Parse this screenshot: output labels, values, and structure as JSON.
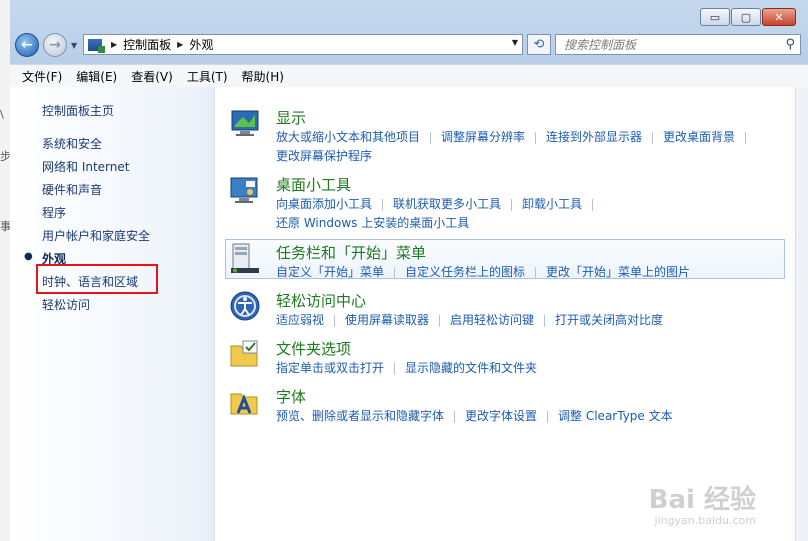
{
  "window": {
    "minimize_glyph": "▭",
    "maximize_glyph": "▢",
    "close_glyph": "✕"
  },
  "nav": {
    "breadcrumb": [
      "控制面板",
      "外观"
    ],
    "search_placeholder": "搜索控制面板"
  },
  "menu": [
    "文件(F)",
    "编辑(E)",
    "查看(V)",
    "工具(T)",
    "帮助(H)"
  ],
  "sidebar": {
    "home": "控制面板主页",
    "items": [
      "系统和安全",
      "网络和 Internet",
      "硬件和声音",
      "程序",
      "用户帐户和家庭安全",
      "外观",
      "时钟、语言和区域",
      "轻松访问"
    ],
    "current": "外观"
  },
  "categories": [
    {
      "title": "显示",
      "icon": "display-icon",
      "links": [
        "放大或缩小文本和其他项目",
        "调整屏幕分辨率",
        "连接到外部显示器",
        "更改桌面背景",
        "更改屏幕保护程序"
      ]
    },
    {
      "title": "桌面小工具",
      "icon": "gadgets-icon",
      "links": [
        "向桌面添加小工具",
        "联机获取更多小工具",
        "卸载小工具",
        "还原 Windows 上安装的桌面小工具"
      ]
    },
    {
      "title": "任务栏和「开始」菜单",
      "icon": "taskbar-icon",
      "links": [
        "自定义「开始」菜单",
        "自定义任务栏上的图标",
        "更改「开始」菜单上的图片"
      ]
    },
    {
      "title": "轻松访问中心",
      "icon": "ease-of-access-icon",
      "links": [
        "适应弱视",
        "使用屏幕读取器",
        "启用轻松访问键",
        "打开或关闭高对比度"
      ]
    },
    {
      "title": "文件夹选项",
      "icon": "folder-options-icon",
      "links": [
        "指定单击或双击打开",
        "显示隐藏的文件和文件夹"
      ]
    },
    {
      "title": "字体",
      "icon": "fonts-icon",
      "links": [
        "预览、删除或者显示和隐藏字体",
        "更改字体设置",
        "调整 ClearType 文本"
      ]
    }
  ],
  "watermark": {
    "brand": "Bai 经验",
    "site": "jingyan.baidu.com"
  }
}
